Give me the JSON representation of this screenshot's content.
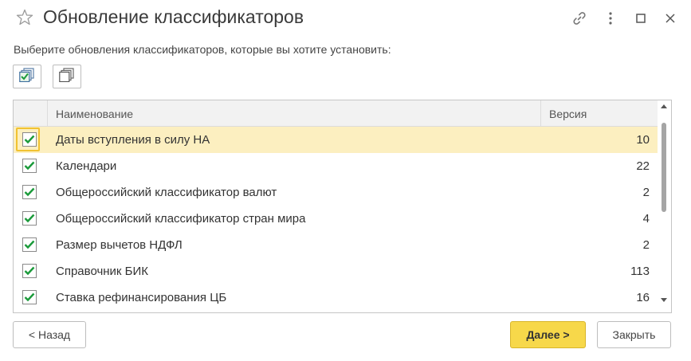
{
  "window": {
    "title": "Обновление классификаторов",
    "icons": [
      "star-icon",
      "link-icon",
      "more-vertical-icon",
      "maximize-icon",
      "close-icon"
    ]
  },
  "instruction": "Выберите обновления классификаторов, которые вы хотите установить:",
  "toolbar": {
    "select_all_icon": "check-all-icon",
    "deselect_all_icon": "uncheck-all-icon"
  },
  "table": {
    "columns": [
      "Наименование",
      "Версия"
    ],
    "rows": [
      {
        "name": "Даты вступления в силу НА",
        "version": "10",
        "checked": true,
        "selected": true
      },
      {
        "name": "Календари",
        "version": "22",
        "checked": true,
        "selected": false
      },
      {
        "name": "Общероссийский классификатор валют",
        "version": "2",
        "checked": true,
        "selected": false
      },
      {
        "name": "Общероссийский классификатор стран мира",
        "version": "4",
        "checked": true,
        "selected": false
      },
      {
        "name": "Размер вычетов НДФЛ",
        "version": "2",
        "checked": true,
        "selected": false
      },
      {
        "name": "Справочник БИК",
        "version": "113",
        "checked": true,
        "selected": false
      },
      {
        "name": "Ставка рефинансирования ЦБ",
        "version": "16",
        "checked": true,
        "selected": false
      }
    ]
  },
  "buttons": {
    "back": "< Назад",
    "next": "Далее >",
    "close": "Закрыть"
  },
  "colors": {
    "accent_yellow": "#f7d84a",
    "selected_row": "#fcefc0",
    "check_green": "#1a9a3a"
  }
}
